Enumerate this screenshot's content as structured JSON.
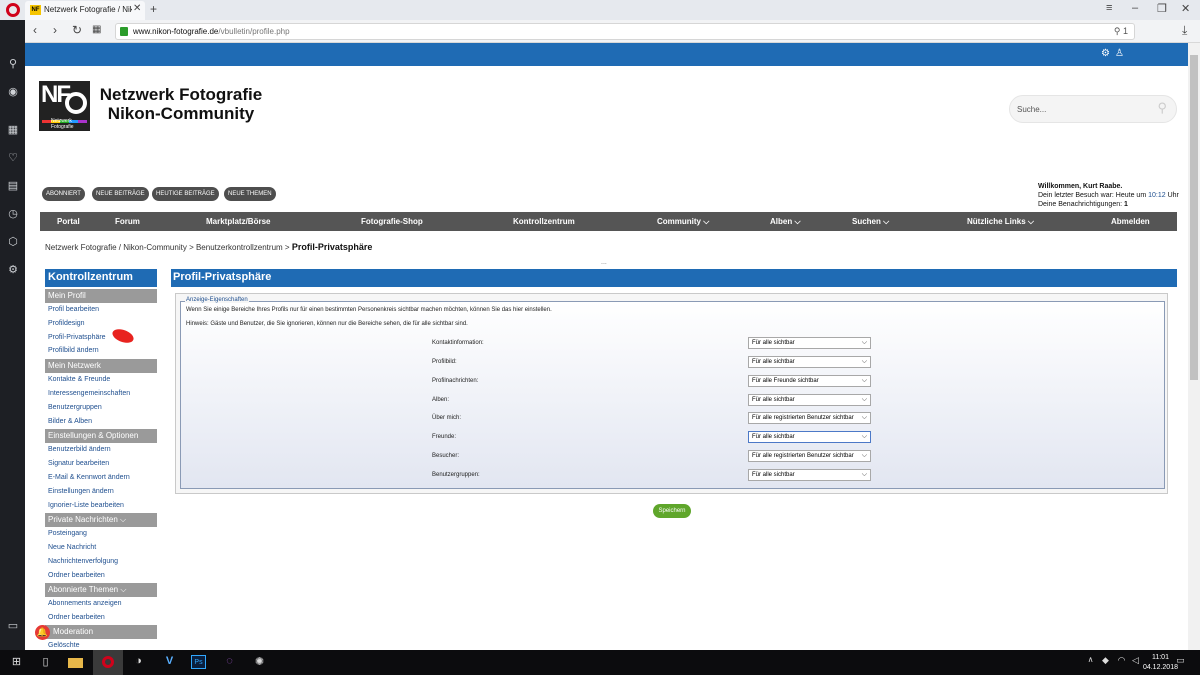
{
  "browser": {
    "tab_title": "Netzwerk Fotografie / Nik",
    "tab_favicon": "NF",
    "url_host": "www.nikon-fotografie.de",
    "url_path": "/vbulletin/profile.php",
    "addr_right": "⚲ 1"
  },
  "site": {
    "title_line1": "Netzwerk Fotografie",
    "title_line2": "Nikon-Community",
    "logo_text": "NF",
    "logo_sub": "Netzwerk Fotografie",
    "search_placeholder": "Suche...",
    "accent": "#1f6bb4"
  },
  "pills": [
    "ABONNIERT",
    "NEUE BEITRÄGE",
    "HEUTIGE BEITRÄGE",
    "NEUE THEMEN"
  ],
  "welcome": {
    "line1": "Willkommen, Kurt Raabe.",
    "line2_prefix": "Dein letzter Besuch war: Heute um ",
    "line2_time": "10:12",
    "line2_suffix": " Uhr",
    "line3_prefix": "Deine Benachrichtigungen: ",
    "line3_count": "1"
  },
  "nav": [
    "Portal",
    "Forum",
    "Marktplatz/Börse",
    "Fotografie-Shop",
    "Kontrollzentrum",
    "Community",
    "Alben",
    "Suchen",
    "Nützliche Links",
    "Abmelden"
  ],
  "breadcrumb": {
    "a": "Netzwerk Fotografie / Nikon-Community",
    "sep": ">",
    "b": "Benutzerkontrollzentrum",
    "current": "Profil-Privatsphäre"
  },
  "dots": "...",
  "left": {
    "head": "Kontrollzentrum",
    "sections": [
      "Mein Profil",
      "Mein Netzwerk",
      "Einstellungen & Optionen",
      "Private Nachrichten",
      "Abonnierte Themen",
      "Moderation"
    ],
    "links": {
      "profil": [
        "Profil bearbeiten",
        "Profildesign",
        "Profil-Privatsphäre",
        "Profilbild ändern"
      ],
      "netzwerk": [
        "Kontakte & Freunde",
        "Interessengemeinschaften",
        "Benutzergruppen",
        "Bilder & Alben"
      ],
      "einstellungen": [
        "Benutzerbild ändern",
        "Signatur bearbeiten",
        "E-Mail & Kennwort ändern",
        "Einstellungen ändern",
        "Ignorier-Liste bearbeiten"
      ],
      "pn": [
        "Posteingang",
        "Neue Nachricht",
        "Nachrichtenverfolgung",
        "Ordner bearbeiten"
      ],
      "abo": [
        "Abonnements anzeigen",
        "Ordner bearbeiten"
      ],
      "mod": [
        "Gelöschte"
      ]
    }
  },
  "content": {
    "head": "Profil-Privatsphäre",
    "legend": "Anzeige-Eigenschaften",
    "info1": "Wenn Sie einige Bereiche Ihres Profils nur für einen bestimmten Personenkreis sichtbar machen möchten, können Sie das hier einstellen.",
    "info2": "Hinweis: Gäste und Benutzer, die Sie ignorieren, können nur die Bereiche sehen, die für alle sichtbar sind.",
    "fields": [
      {
        "label": "Kontaktinformation:",
        "value": "Für alle sichtbar"
      },
      {
        "label": "Profilbild:",
        "value": "Für alle sichtbar"
      },
      {
        "label": "Profilnachrichten:",
        "value": "Für alle Freunde sichtbar"
      },
      {
        "label": "Alben:",
        "value": "Für alle sichtbar"
      },
      {
        "label": "Über mich:",
        "value": "Für alle registrierten Benutzer sichtbar"
      },
      {
        "label": "Freunde:",
        "value": "Für alle sichtbar"
      },
      {
        "label": "Besucher:",
        "value": "Für alle registrierten Benutzer sichtbar"
      },
      {
        "label": "Benutzergruppen:",
        "value": "Für alle sichtbar"
      }
    ],
    "save_label": "Speichern"
  },
  "taskbar": {
    "time": "11:01",
    "date": "04.12.2018"
  }
}
